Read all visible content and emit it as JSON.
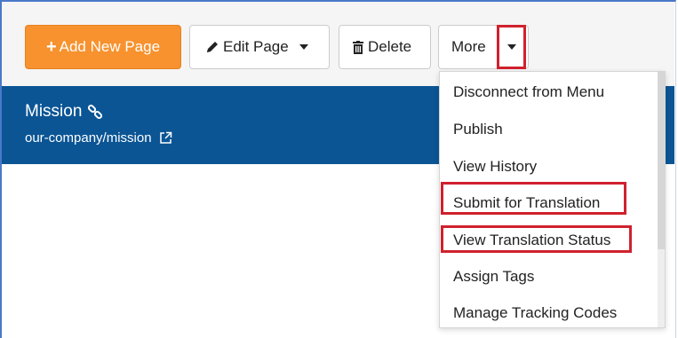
{
  "toolbar": {
    "add_label": "Add New Page",
    "edit_label": "Edit Page",
    "delete_label": "Delete",
    "more_label": "More"
  },
  "page": {
    "title": "Mission",
    "path": "our-company/mission"
  },
  "more_menu": {
    "items": [
      "Disconnect from Menu",
      "Publish",
      "View History",
      "Submit for Translation",
      "View Translation Status",
      "Assign Tags",
      "Manage Tracking Codes"
    ]
  },
  "colors": {
    "primary_button": "#f7922e",
    "header_bar": "#0b5595",
    "annotation_red": "#d0212e"
  },
  "icons": {
    "add": "plus-icon",
    "edit": "pencil-icon",
    "delete": "trash-icon",
    "more": "chevron-down-icon",
    "title_link": "link-icon",
    "path_external": "external-link-icon"
  }
}
